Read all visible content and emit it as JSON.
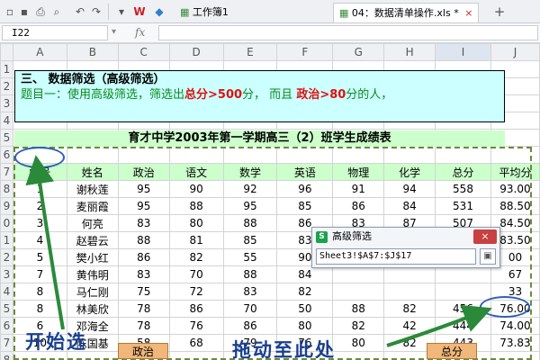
{
  "toolbar": {
    "icons": [
      "save-icon",
      "save-as-icon",
      "print-icon",
      "print-preview-icon",
      "undo-icon",
      "redo-icon",
      "dropdown-icon"
    ],
    "tabs": [
      {
        "label": "工作簿1",
        "active": false
      },
      {
        "label": "04：数据清单操作.xls *",
        "active": true
      }
    ],
    "add_tab": "+"
  },
  "formula_bar": {
    "cell_ref": "I22",
    "fx": "fx",
    "value": ""
  },
  "columns": [
    "A",
    "B",
    "C",
    "D",
    "E",
    "F",
    "G",
    "H",
    "I",
    "J"
  ],
  "selected_column": "I",
  "row_numbers": [
    "1",
    "2",
    "3",
    "4",
    "5",
    "6",
    "7",
    "8",
    "9",
    "0",
    "1",
    "2",
    "3",
    "4",
    "5",
    "6",
    "7",
    "8"
  ],
  "note": {
    "line1": "三、  数据筛选（高级筛选）",
    "line2_prefix": "题目一：使用高级筛选，筛选出",
    "line2_red1": "总分>500",
    "line2_mid": "分，  而且  ",
    "line2_red2": "政治>80",
    "line2_suffix": "分的人，"
  },
  "table_title": "育才中学2003年第一学期高三（2）班学生成绩表",
  "headers": [
    "学号",
    "姓名",
    "政治",
    "语文",
    "数学",
    "英语",
    "物理",
    "化学",
    "总分",
    "平均分"
  ],
  "rows": [
    [
      "1",
      "谢秋莲",
      "95",
      "90",
      "92",
      "96",
      "91",
      "94",
      "558",
      "93.00"
    ],
    [
      "2",
      "麦丽霞",
      "95",
      "88",
      "95",
      "85",
      "86",
      "84",
      "531",
      "88.50"
    ],
    [
      "3",
      "何亮",
      "83",
      "80",
      "88",
      "86",
      "83",
      "87",
      "507",
      "84.50"
    ],
    [
      "4",
      "赵碧云",
      "88",
      "81",
      "85",
      "83",
      "84",
      "80",
      "501",
      "83.50"
    ],
    [
      "5",
      "樊小红",
      "86",
      "82",
      "55",
      "90",
      "",
      "",
      "",
      "00"
    ],
    [
      "7",
      "黄伟明",
      "83",
      "70",
      "88",
      "84",
      "",
      "",
      "",
      "67"
    ],
    [
      "8",
      "马仁刚",
      "75",
      "72",
      "83",
      "82",
      "",
      "",
      "",
      "33"
    ],
    [
      "8",
      "林美欣",
      "78",
      "86",
      "70",
      "50",
      "88",
      "82",
      "456",
      "76.00"
    ],
    [
      "6",
      "邓海全",
      "78",
      "76",
      "86",
      "80",
      "82",
      "42",
      "444",
      "74.00"
    ],
    [
      "10",
      "陈国基",
      "58",
      "68",
      "79",
      "76",
      "80",
      "82",
      "443",
      "73.83"
    ]
  ],
  "criteria": {
    "politics": "政治",
    "total": "总分"
  },
  "annotations": {
    "start": "开始选",
    "drag": "拖动至此处"
  },
  "dialog": {
    "logo": "S",
    "title": "高级筛选",
    "range": "Sheet3!$A$7:$J$17",
    "close": "×",
    "pick": "▣"
  },
  "colors": {
    "note_bg": "#ccffff",
    "header_bg": "#ccffcc",
    "criteria_bg": "#f0b67a",
    "annotation": "#2f5fb5",
    "highlight_red": "#e01010",
    "note_text_green": "#0b8a1f"
  }
}
